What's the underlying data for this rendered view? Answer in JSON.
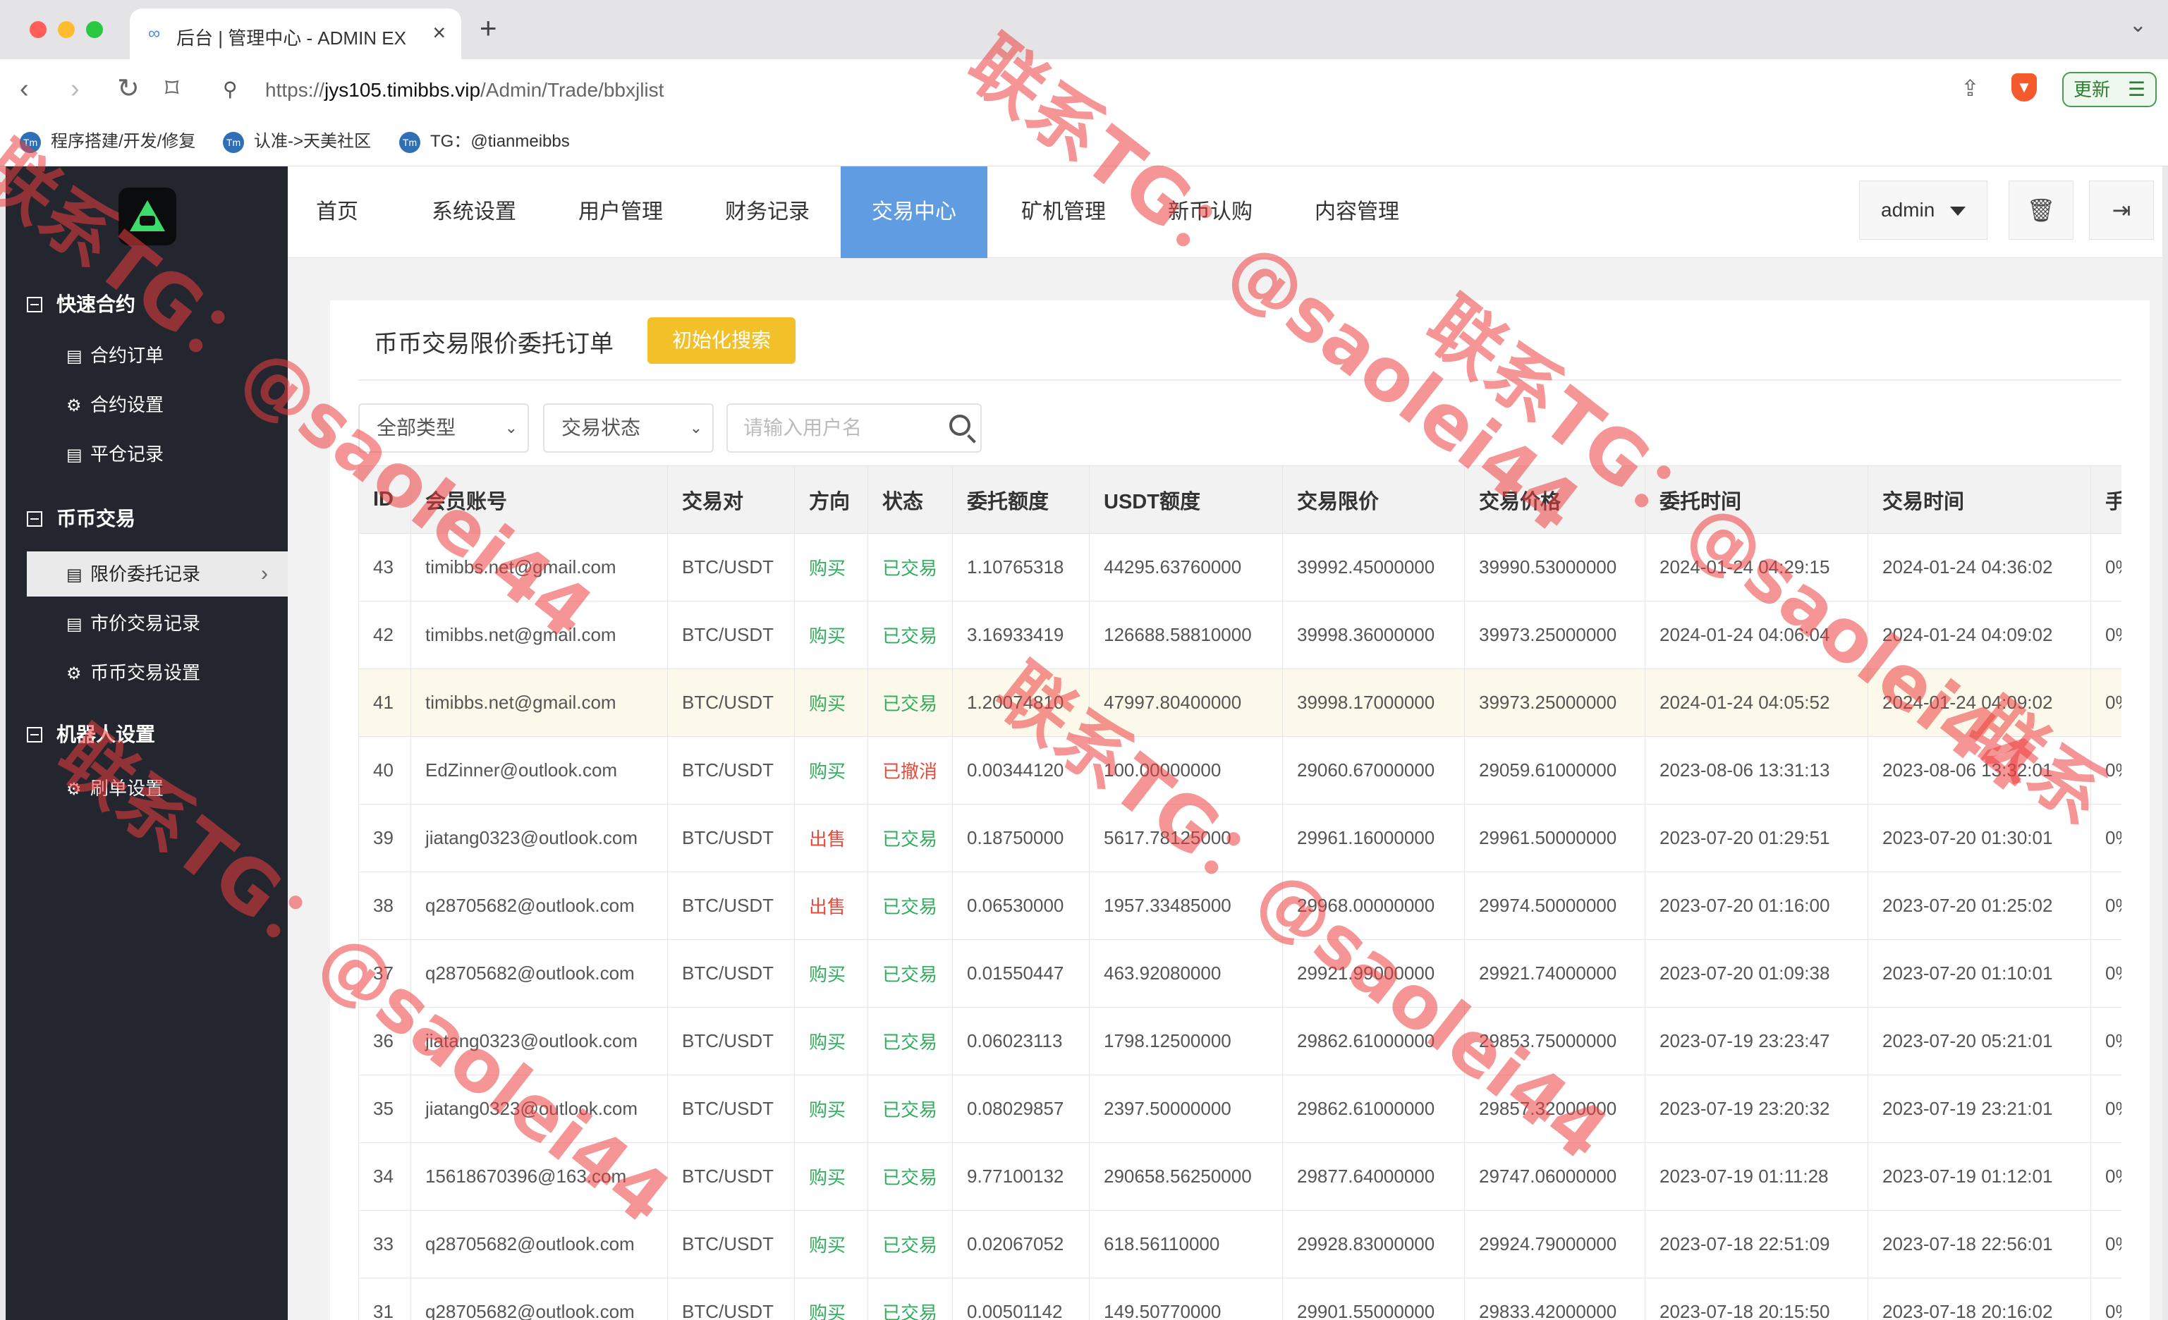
{
  "browser": {
    "tab_title": "后台 | 管理中心 - ADMIN EX",
    "url_prefix": "https://",
    "url_host": "jys105.timibbs.vip",
    "url_path": "/Admin/Trade/bbxjlist",
    "update_label": "更新",
    "bookmarks": [
      {
        "label": "程序搭建/开发/修复"
      },
      {
        "label": "认准->天美社区"
      },
      {
        "label": "TG：@tianmeibbs"
      }
    ]
  },
  "sidebar": {
    "groups": [
      {
        "label": "快速合约",
        "items": [
          {
            "label": "合约订单",
            "icon": "list-icon"
          },
          {
            "label": "合约设置",
            "icon": "gear-icon"
          },
          {
            "label": "平仓记录",
            "icon": "list-icon"
          }
        ]
      },
      {
        "label": "币币交易",
        "items": [
          {
            "label": "限价委托记录",
            "icon": "list-icon",
            "active": true
          },
          {
            "label": "市价交易记录",
            "icon": "list-icon"
          },
          {
            "label": "币币交易设置",
            "icon": "gear-icon"
          }
        ]
      },
      {
        "label": "机器人设置",
        "items": [
          {
            "label": "刷单设置",
            "icon": "gear-icon"
          }
        ]
      }
    ]
  },
  "topnav": {
    "items": [
      "首页",
      "系统设置",
      "用户管理",
      "财务记录",
      "交易中心",
      "矿机管理",
      "新币认购",
      "内容管理"
    ],
    "active": "交易中心",
    "user": "admin"
  },
  "panel": {
    "title": "币币交易限价委托订单",
    "init_search_label": "初始化搜索",
    "type_select": "全部类型",
    "status_select": "交易状态",
    "search_placeholder": "请输入用户名"
  },
  "table": {
    "columns": [
      "ID",
      "会员账号",
      "交易对",
      "方向",
      "状态",
      "委托额度",
      "USDT额度",
      "交易限价",
      "交易价格",
      "委托时间",
      "交易时间",
      "手"
    ],
    "rows": [
      [
        "43",
        "timibbs.net@gmail.com",
        "BTC/USDT",
        "购买",
        "已交易",
        "1.10765318",
        "44295.63760000",
        "39992.45000000",
        "39990.53000000",
        "2024-01-24 04:29:15",
        "2024-01-24 04:36:02",
        "0%"
      ],
      [
        "42",
        "timibbs.net@gmail.com",
        "BTC/USDT",
        "购买",
        "已交易",
        "3.16933419",
        "126688.58810000",
        "39998.36000000",
        "39973.25000000",
        "2024-01-24 04:06:04",
        "2024-01-24 04:09:02",
        "0%"
      ],
      [
        "41",
        "timibbs.net@gmail.com",
        "BTC/USDT",
        "购买",
        "已交易",
        "1.20074810",
        "47997.80400000",
        "39998.17000000",
        "39973.25000000",
        "2024-01-24 04:05:52",
        "2024-01-24 04:09:02",
        "0%"
      ],
      [
        "40",
        "EdZinner@outlook.com",
        "BTC/USDT",
        "购买",
        "已撤消",
        "0.00344120",
        "100.00000000",
        "29060.67000000",
        "29059.61000000",
        "2023-08-06 13:31:13",
        "2023-08-06 13:32:01",
        "0%"
      ],
      [
        "39",
        "jiatang0323@outlook.com",
        "BTC/USDT",
        "出售",
        "已交易",
        "0.18750000",
        "5617.78125000",
        "29961.16000000",
        "29961.50000000",
        "2023-07-20 01:29:51",
        "2023-07-20 01:30:01",
        "0%"
      ],
      [
        "38",
        "q28705682@outlook.com",
        "BTC/USDT",
        "出售",
        "已交易",
        "0.06530000",
        "1957.33485000",
        "29968.00000000",
        "29974.50000000",
        "2023-07-20 01:16:00",
        "2023-07-20 01:25:02",
        "0%"
      ],
      [
        "37",
        "q28705682@outlook.com",
        "BTC/USDT",
        "购买",
        "已交易",
        "0.01550447",
        "463.92080000",
        "29921.99000000",
        "29921.74000000",
        "2023-07-20 01:09:38",
        "2023-07-20 01:10:01",
        "0%"
      ],
      [
        "36",
        "jiatang0323@outlook.com",
        "BTC/USDT",
        "购买",
        "已交易",
        "0.06023113",
        "1798.12500000",
        "29862.61000000",
        "29853.75000000",
        "2023-07-19 23:23:47",
        "2023-07-20 05:21:01",
        "0%"
      ],
      [
        "35",
        "jiatang0323@outlook.com",
        "BTC/USDT",
        "购买",
        "已交易",
        "0.08029857",
        "2397.50000000",
        "29862.61000000",
        "29857.32000000",
        "2023-07-19 23:20:32",
        "2023-07-19 23:21:01",
        "0%"
      ],
      [
        "34",
        "15618670396@163.com",
        "BTC/USDT",
        "购买",
        "已交易",
        "9.77100132",
        "290658.56250000",
        "29877.64000000",
        "29747.06000000",
        "2023-07-19 01:11:28",
        "2023-07-19 01:12:01",
        "0%"
      ],
      [
        "33",
        "q28705682@outlook.com",
        "BTC/USDT",
        "购买",
        "已交易",
        "0.02067052",
        "618.56110000",
        "29928.83000000",
        "29924.79000000",
        "2023-07-18 22:51:09",
        "2023-07-18 22:56:01",
        "0%"
      ],
      [
        "31",
        "q28705682@outlook.com",
        "BTC/USDT",
        "购买",
        "已交易",
        "0.00501142",
        "149.50770000",
        "29901.55000000",
        "29833.42000000",
        "2023-07-18 20:15:50",
        "2023-07-18 20:16:02",
        "0%"
      ]
    ],
    "highlight_row_id": "41"
  },
  "colors": {
    "sidebar_bg": "#23262e",
    "nav_active": "#5f9ce1",
    "init_button": "#f2c12a",
    "buy_green": "#2fae5b",
    "sell_red": "#e64a3b",
    "watermark": "#ec3e3e"
  },
  "watermarks": [
    {
      "text": "联系TG：@saolei44"
    },
    {
      "text": "联系TG：@saolei44"
    },
    {
      "text": "联系TG：@saolei44"
    },
    {
      "text": "联系TG：@saolei44"
    },
    {
      "text": "联系TG：@saolei44"
    },
    {
      "text": "联系"
    }
  ]
}
